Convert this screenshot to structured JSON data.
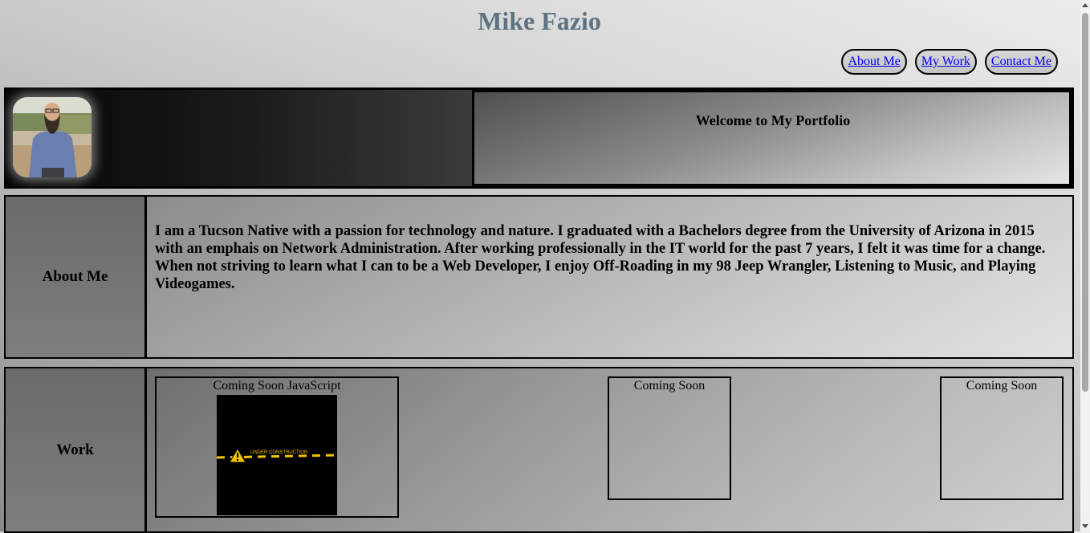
{
  "site": {
    "title": "Mike Fazio"
  },
  "nav": {
    "items": [
      {
        "label": "About Me"
      },
      {
        "label": "My Work"
      },
      {
        "label": "Contact Me"
      }
    ]
  },
  "hero": {
    "welcome": "Welcome to My Portfolio"
  },
  "about": {
    "label": "About Me",
    "text": "I am a Tucson Native with a passion for technology and nature. I graduated with a Bachelors degree from the University of Arizona in 2015 with an emphais on Network Administration. After working professionally in the IT world for the past 7 years, I felt it was time for a change. When not striving to learn what I can to be a Web Developer, I enjoy Off-Roading in my 98 Jeep Wrangler, Listening to Music, and Playing Videogames."
  },
  "work": {
    "label": "Work",
    "cards": [
      {
        "title": "Coming Soon JavaScript",
        "image_text": "UNDER CONSTRUCTION"
      },
      {
        "title": "Coming Soon"
      },
      {
        "title": "Coming Soon"
      }
    ]
  },
  "colors": {
    "title": "#5d7382",
    "link": "#0000ee",
    "construction_yellow": "#f2c200"
  },
  "icons": {
    "warning": "warning-triangle-icon",
    "avatar": "profile-photo"
  }
}
